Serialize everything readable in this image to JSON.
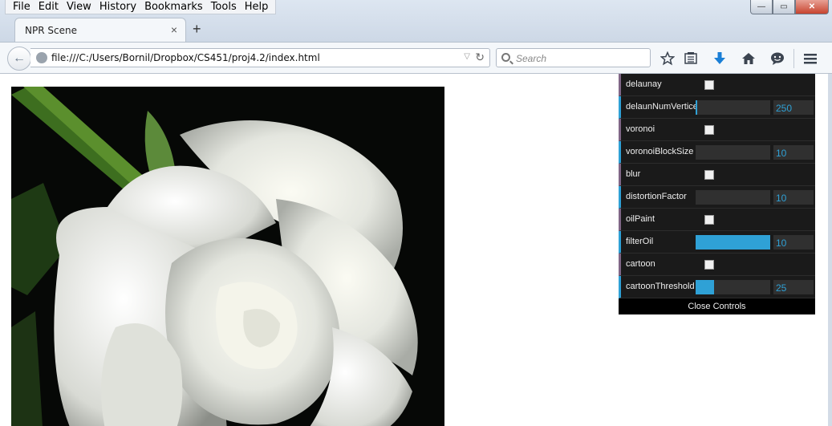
{
  "menu": [
    "File",
    "Edit",
    "View",
    "History",
    "Bookmarks",
    "Tools",
    "Help"
  ],
  "window_controls": {
    "minimize": "—",
    "maximize": "▭",
    "close": "✕"
  },
  "tab": {
    "title": "NPR Scene",
    "close": "×",
    "new_tab": "+"
  },
  "nav": {
    "back": "←",
    "url": "file:///C:/Users/Bornil/Dropbox/CS451/proj4.2/index.html",
    "url_dropdown": "▽",
    "reload": "↻",
    "search_placeholder": "Search"
  },
  "toolbar_icons": [
    "star-icon",
    "reading-list-icon",
    "download-icon",
    "home-icon",
    "chat-icon",
    "hamburger-menu-icon"
  ],
  "colors": {
    "gui_bg": "#1a1a1a",
    "number_accent": "#2fa1d6",
    "boolean_accent": "#806787"
  },
  "gui": {
    "controls": [
      {
        "label": "delaunay",
        "type": "boolean",
        "checked": false
      },
      {
        "label": "delaunNumVertice",
        "type": "number",
        "value": "250",
        "fill": 0.01
      },
      {
        "label": "voronoi",
        "type": "boolean",
        "checked": false
      },
      {
        "label": "voronoiBlockSize",
        "type": "number",
        "value": "10",
        "fill": 0
      },
      {
        "label": "blur",
        "type": "boolean",
        "checked": false
      },
      {
        "label": "distortionFactor",
        "type": "number",
        "value": "10",
        "fill": 0
      },
      {
        "label": "oilPaint",
        "type": "boolean",
        "checked": false
      },
      {
        "label": "filterOil",
        "type": "number",
        "value": "10",
        "fill": 1.0
      },
      {
        "label": "cartoon",
        "type": "boolean",
        "checked": false
      },
      {
        "label": "cartoonThreshold",
        "type": "number",
        "value": "25",
        "fill": 0.25
      }
    ],
    "close_label": "Close Controls"
  }
}
